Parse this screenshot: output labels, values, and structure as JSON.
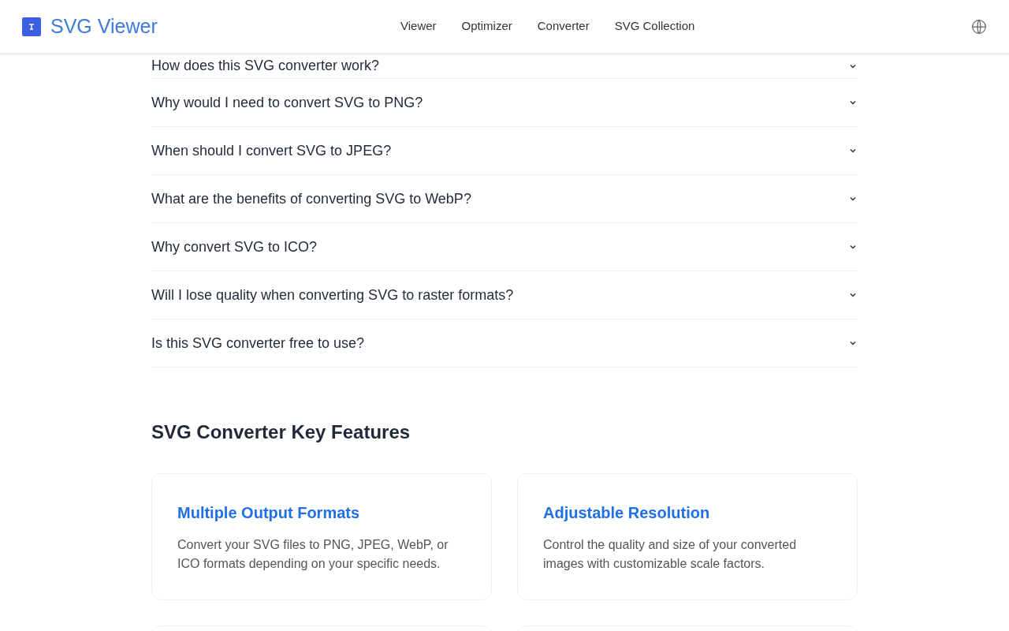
{
  "header": {
    "brand": "SVG Viewer",
    "nav": [
      {
        "label": "Viewer"
      },
      {
        "label": "Optimizer"
      },
      {
        "label": "Converter"
      },
      {
        "label": "SVG Collection"
      }
    ]
  },
  "faq": [
    {
      "question": "How does this SVG converter work?",
      "expanded": false
    },
    {
      "question": "Why would I need to convert SVG to PNG?",
      "expanded": false
    },
    {
      "question": "When should I convert SVG to JPEG?",
      "expanded": false
    },
    {
      "question": "What are the benefits of converting SVG to WebP?",
      "expanded": false
    },
    {
      "question": "Why convert SVG to ICO?",
      "expanded": false
    },
    {
      "question": "Will I lose quality when converting SVG to raster formats?",
      "expanded": false
    },
    {
      "question": "Is this SVG converter free to use?",
      "expanded": false
    }
  ],
  "features": {
    "title": "SVG Converter Key Features",
    "cards": [
      {
        "title": "Multiple Output Formats",
        "text": "Convert your SVG files to PNG, JPEG, WebP, or ICO formats depending on your specific needs."
      },
      {
        "title": "Adjustable Resolution",
        "text": "Control the quality and size of your converted images with customizable scale factors."
      }
    ]
  }
}
